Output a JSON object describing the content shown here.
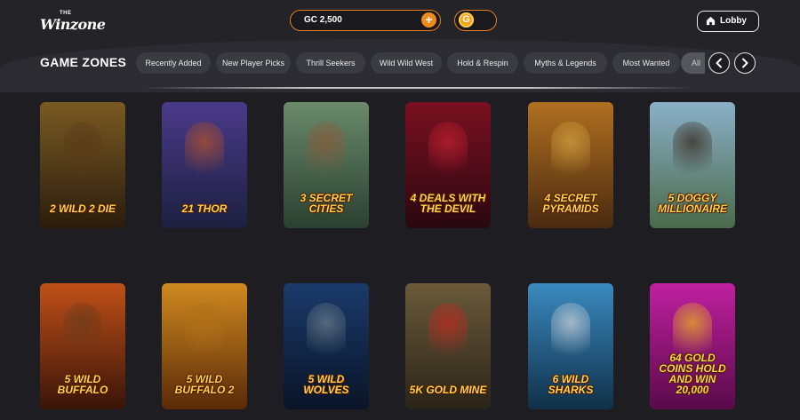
{
  "header": {
    "logo_top": "THE",
    "logo_name": "Winzone",
    "balance_text": "GC 2,500",
    "add_symbol": "+",
    "coin_symbol": "G",
    "lobby_label": "Lobby"
  },
  "zones": {
    "title": "GAME ZONES",
    "chips": [
      "Recently Added",
      "New Player Picks",
      "Thrill Seekers",
      "Wild Wild West",
      "Hold & Respin",
      "Myths & Legends",
      "Most Wanted",
      "All"
    ]
  },
  "games": [
    {
      "label": "2 WILD 2 DIE",
      "bg1": "#7a5a22",
      "bg2": "#2a1c0c",
      "fig": "#5a3a1a"
    },
    {
      "label": "21 THOR",
      "bg1": "#4a3a8a",
      "bg2": "#1c2040",
      "fig": "#b0502a"
    },
    {
      "label": "3 SECRET CITIES",
      "bg1": "#6a8a6a",
      "bg2": "#2a4030",
      "fig": "#8a5a3a"
    },
    {
      "label": "4 DEALS WITH THE DEVIL",
      "bg1": "#7a1020",
      "bg2": "#2a0810",
      "fig": "#c02030"
    },
    {
      "label": "4 SECRET PYRAMIDS",
      "bg1": "#b07020",
      "bg2": "#4a2a10",
      "fig": "#d0a040"
    },
    {
      "label": "5 DOGGY MILLIONAIRE",
      "bg1": "#8ab0c8",
      "bg2": "#4a6a4a",
      "fig": "#3a2a20"
    },
    {
      "label": "5 WILD BUFFALO",
      "bg1": "#c05018",
      "bg2": "#3a1408",
      "fig": "#6a3a1a"
    },
    {
      "label": "5 WILD BUFFALO 2",
      "bg1": "#d08a20",
      "bg2": "#5a2a08",
      "fig": "#b07018"
    },
    {
      "label": "5 WILD WOLVES",
      "bg1": "#1a3a6a",
      "bg2": "#0a1428",
      "fig": "#6a7a8a"
    },
    {
      "label": "5K GOLD MINE",
      "bg1": "#6a5a3a",
      "bg2": "#2a2418",
      "fig": "#c02a20"
    },
    {
      "label": "6 WILD SHARKS",
      "bg1": "#3a8ac0",
      "bg2": "#103048",
      "fig": "#c8d0d8"
    },
    {
      "label": "64 GOLD COINS HOLD AND WIN 20,000",
      "bg1": "#c020a0",
      "bg2": "#5a0a4a",
      "fig": "#e8b020"
    }
  ]
}
